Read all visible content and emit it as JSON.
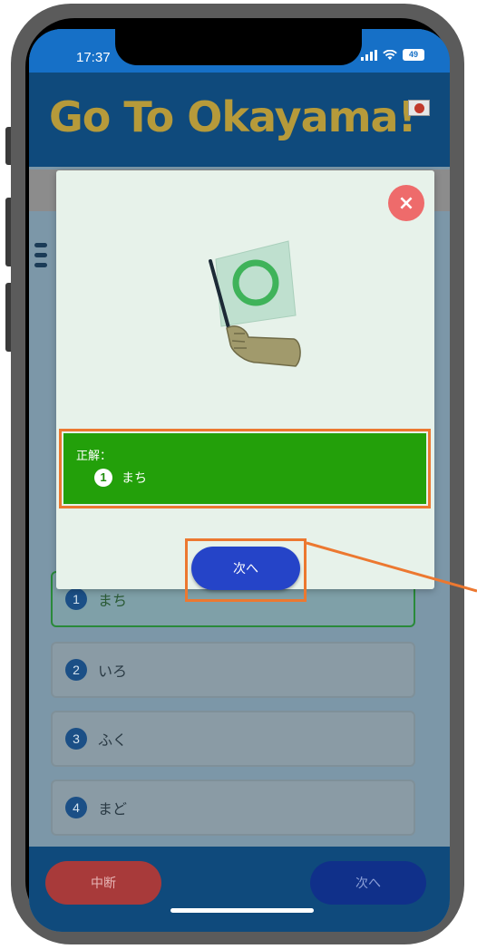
{
  "status_bar": {
    "time": "17:37",
    "battery": "49"
  },
  "header": {
    "title": "Go To Okayama!"
  },
  "options": [
    {
      "number": "1",
      "label": "まち"
    },
    {
      "number": "2",
      "label": "いろ"
    },
    {
      "number": "3",
      "label": "ふく"
    },
    {
      "number": "4",
      "label": "まど"
    }
  ],
  "modal": {
    "close_label": "×",
    "answer_heading": "正解：",
    "answer_number": "1",
    "answer_label": "まち",
    "next_label": "次へ"
  },
  "footer": {
    "quit_label": "中断",
    "next_label": "次へ"
  },
  "colors": {
    "header_bg": "#0f4a7c",
    "title": "#b69a3a",
    "answer_bg": "#23a00a",
    "highlight": "#ec7830",
    "primary_button": "#2544c8"
  }
}
